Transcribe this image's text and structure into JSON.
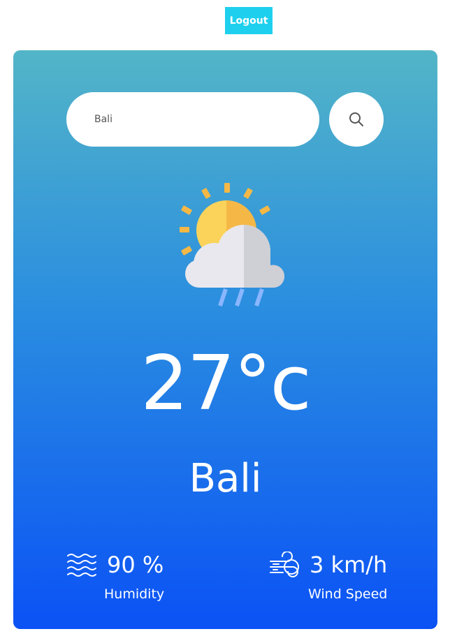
{
  "header": {
    "logout_label": "Logout"
  },
  "search": {
    "value": "Bali",
    "placeholder": "",
    "button_icon": "search-icon"
  },
  "weather": {
    "icon": "sun-cloud-rain-icon",
    "temperature": "27°c",
    "city": "Bali",
    "humidity": {
      "value": "90 %",
      "label": "Humidity",
      "icon": "humidity-waves-icon"
    },
    "wind": {
      "value": "3 km/h",
      "label": "Wind Speed",
      "icon": "wind-icon"
    }
  },
  "colors": {
    "logout_bg": "#1fd0ee",
    "card_gradient_top": "#53b5c7",
    "card_gradient_bottom": "#0b52f5",
    "text": "#ffffff"
  }
}
